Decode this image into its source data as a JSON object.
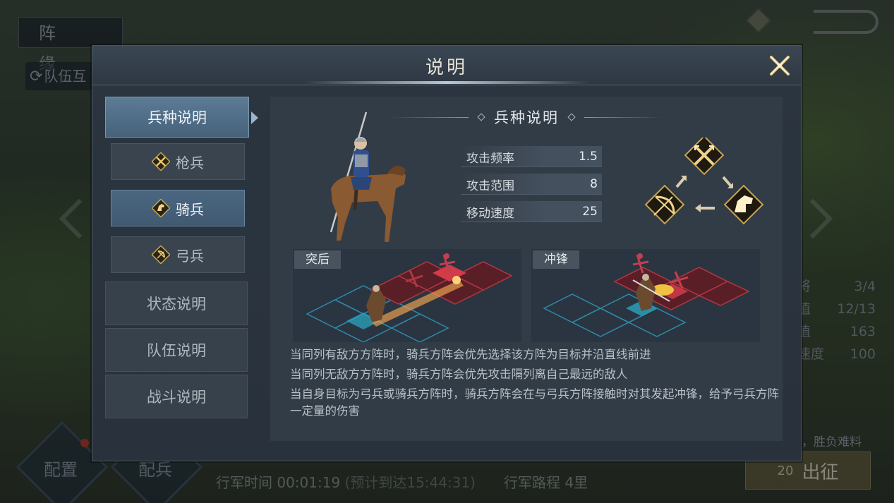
{
  "background": {
    "screen_title": "阵 缘",
    "swap_label": "队伍互",
    "stats": [
      {
        "label": "将",
        "value": "3/4"
      },
      {
        "label": "值",
        "value": "12/13"
      },
      {
        "label": "值",
        "value": "163"
      },
      {
        "label": "速度",
        "value": "100"
      }
    ],
    "note": "，胜负难料",
    "go_cost": "20",
    "go_label": "出征",
    "config_label": "配置",
    "troops_label": "配兵",
    "march_time": "行军时间 00:01:19",
    "march_eta": "(预计到达15:44:31)",
    "march_route": "行军路程 4里"
  },
  "dialog": {
    "title": "说明",
    "close_icon": "close-x-icon"
  },
  "tabs": {
    "main": "兵种说明",
    "sub": [
      {
        "label": "枪兵",
        "icon": "spear-icon"
      },
      {
        "label": "骑兵",
        "icon": "horse-icon"
      },
      {
        "label": "弓兵",
        "icon": "bow-icon"
      }
    ],
    "sections": [
      "状态说明",
      "队伍说明",
      "战斗说明"
    ]
  },
  "content": {
    "heading": "兵种说明",
    "stats": [
      {
        "label": "攻击频率",
        "value": "1.5"
      },
      {
        "label": "攻击范围",
        "value": "8"
      },
      {
        "label": "移动速度",
        "value": "25"
      }
    ],
    "scenes": [
      {
        "label": "突后"
      },
      {
        "label": "冲锋"
      }
    ],
    "description": [
      "当同列有敌方方阵时，骑兵方阵会优先选择该方阵为目标并沿直线前进",
      "当同列无敌方方阵时，骑兵方阵会优先攻击隔列离自己最远的敌人",
      "当自身目标为弓兵或骑兵方阵时，骑兵方阵会在与弓兵方阵接触时对其发起冲锋，给予弓兵方阵一定量的伤害"
    ]
  },
  "colors": {
    "accent_gold": "#e8c46a",
    "ally_tile": "#2e7f9a",
    "enemy_tile": "#8c2a33"
  }
}
